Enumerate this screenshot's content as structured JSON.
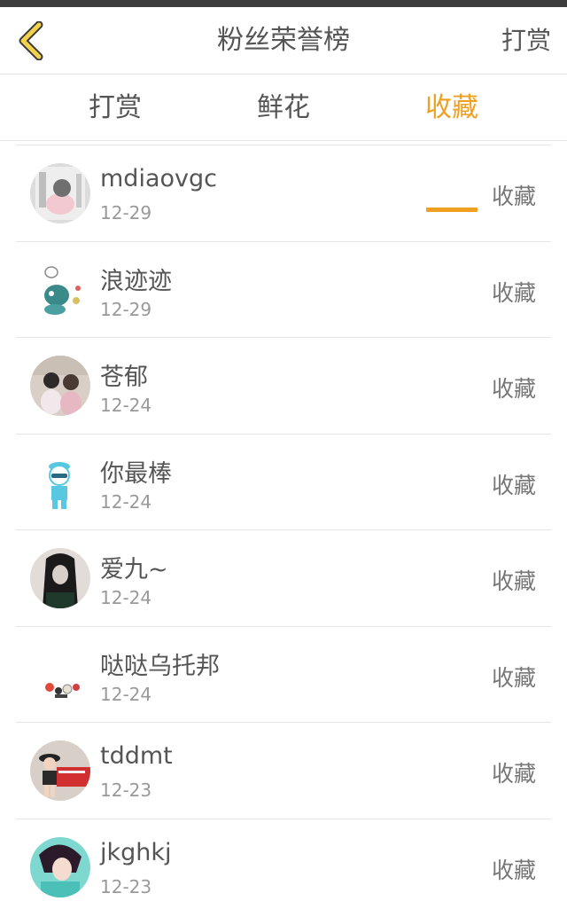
{
  "header": {
    "title": "粉丝荣誉榜",
    "right_action": "打赏",
    "back_icon": "chevron-left-icon",
    "back_color": "#f0b400"
  },
  "tabs": [
    {
      "label": "打赏",
      "active": false
    },
    {
      "label": "鲜花",
      "active": false
    },
    {
      "label": "收藏",
      "active": true
    }
  ],
  "accent_color": "#f0a020",
  "rows": [
    {
      "name": "mdiaovgc",
      "date": "12-29",
      "action": "收藏"
    },
    {
      "name": "浪迹迹",
      "date": "12-29",
      "action": "收藏"
    },
    {
      "name": "苍郁",
      "date": "12-24",
      "action": "收藏"
    },
    {
      "name": "你最棒",
      "date": "12-24",
      "action": "收藏"
    },
    {
      "name": "爱九~",
      "date": "12-24",
      "action": "收藏"
    },
    {
      "name": "哒哒乌托邦",
      "date": "12-24",
      "action": "收藏"
    },
    {
      "name": "tddmt",
      "date": "12-23",
      "action": "收藏"
    },
    {
      "name": "jkghkj",
      "date": "12-23",
      "action": "收藏"
    }
  ]
}
